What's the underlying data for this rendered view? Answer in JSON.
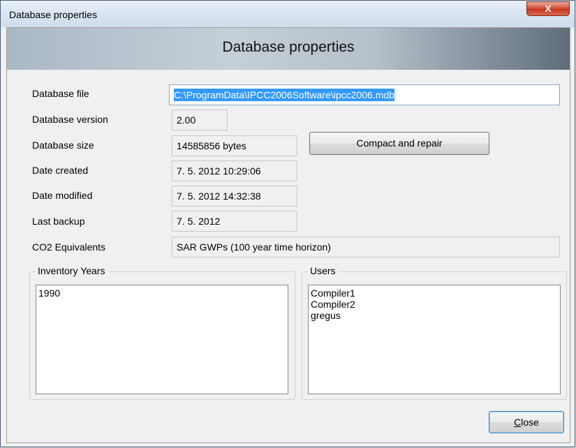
{
  "window": {
    "title": "Database properties",
    "close_glyph": "X"
  },
  "header": {
    "title": "Database properties"
  },
  "fields": {
    "database_file": {
      "label": "Database file",
      "value": "C:\\ProgramData\\IPCC2006Software\\ipcc2006.mdb"
    },
    "database_version": {
      "label": "Database version",
      "value": "2.00"
    },
    "database_size": {
      "label": "Database size",
      "value": "14585856 bytes"
    },
    "date_created": {
      "label": "Date created",
      "value": "7. 5. 2012 10:29:06"
    },
    "date_modified": {
      "label": "Date modified",
      "value": "7. 5. 2012 14:32:38"
    },
    "last_backup": {
      "label": "Last backup",
      "value": "7. 5. 2012"
    },
    "co2_equivalents": {
      "label": "CO2 Equivalents",
      "value": "SAR GWPs (100 year time horizon)"
    }
  },
  "buttons": {
    "compact_repair": "Compact and repair",
    "close_first": "C",
    "close_rest": "lose"
  },
  "inventory_years": {
    "title": "Inventory Years",
    "items": [
      "1990"
    ]
  },
  "users": {
    "title": "Users",
    "items": [
      "Compiler1",
      "Compiler2",
      "gregus"
    ]
  },
  "colors": {
    "selection": "#3399ff",
    "close_button": "#c7371e"
  }
}
